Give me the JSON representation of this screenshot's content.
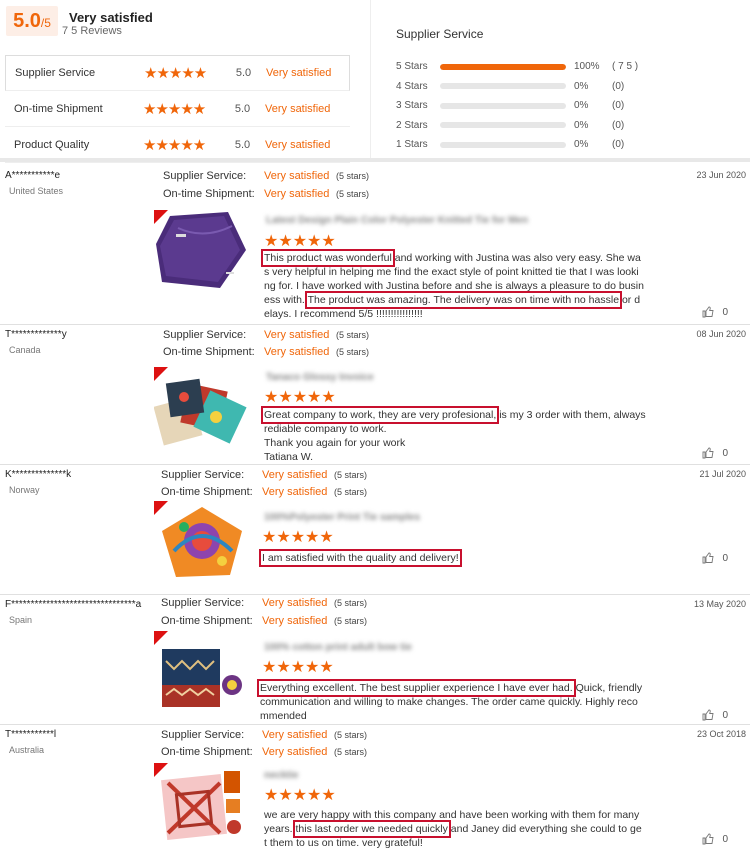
{
  "summary": {
    "score": "5.0",
    "score_suffix": "/5",
    "label": "Very satisfied",
    "review_count": "7 5 Reviews",
    "rows": [
      {
        "label": "Supplier Service",
        "score": "5.0",
        "word": "Very satisfied",
        "stars": 5
      },
      {
        "label": "On-time Shipment",
        "score": "5.0",
        "word": "Very satisfied",
        "stars": 5
      },
      {
        "label": "Product Quality",
        "score": "5.0",
        "word": "Very satisfied",
        "stars": 5
      }
    ],
    "breakdown_title": "Supplier Service",
    "breakdown": [
      {
        "label": "5 Stars",
        "fraction": 1.0,
        "pct": "100%",
        "count": "( 7 5 )"
      },
      {
        "label": "4 Stars",
        "fraction": 0,
        "pct": "0%",
        "count": "(0)"
      },
      {
        "label": "3 Stars",
        "fraction": 0,
        "pct": "0%",
        "count": "(0)"
      },
      {
        "label": "2 Stars",
        "fraction": 0,
        "pct": "0%",
        "count": "(0)"
      },
      {
        "label": "1 Stars",
        "fraction": 0,
        "pct": "0%",
        "count": "(0)"
      }
    ]
  },
  "labels": {
    "supplier_service": "Supplier Service:",
    "on_time_shipment": "On-time Shipment:",
    "very_satisfied": "Very satisfied",
    "five_stars": "(5 stars)",
    "star_glyphs": "★★★★★",
    "likes": "0"
  },
  "reviews": [
    {
      "name": "A***********e",
      "country": "United States",
      "date": "23 Jun 2020",
      "product_title": "Latest Design Plain Color Polyester Knitted Tie for Men",
      "lines": [
        "This product was wonderful and working with Justina was also very easy. She wa",
        "s very helpful in helping me find the exact style of point knitted tie that I was looki",
        "ng for. I have worked with Justina before and she is always a pleasure to do busin",
        "ess with. The product was amazing. The delivery was on time with no hassle or d",
        "elays. I recommend 5/5 !!!!!!!!!!!!!!!!"
      ],
      "highlights": [
        "This product was wonderful",
        "The product was amazing. The delivery was on time with no hassle"
      ]
    },
    {
      "name": "T*************y",
      "country": "Canada",
      "date": "08 Jun 2020",
      "product_title": "Tanaco Glossy Invoice",
      "lines": [
        "Great company to work, they are very profesional, is my 3 order with them, always",
        "rediable company to work.",
        "Thank you again for your work",
        "Tatiana W."
      ],
      "highlights": [
        "Great company to work, they are very profesional,"
      ]
    },
    {
      "name": "K**************k",
      "country": "Norway",
      "date": "21 Jul 2020",
      "product_title": "100%Polyester Print Tie samples",
      "lines": [
        "I am satisfied with the quality and delivery!"
      ],
      "highlights": [
        "I am satisfied with the quality and delivery!"
      ]
    },
    {
      "name": "F********************************a",
      "country": "Spain",
      "date": "13 May 2020",
      "product_title": "100% cotton print adult bow tie",
      "lines": [
        "Everything excellent. The best supplier experience I have ever had. Quick, friendly",
        "communication and willing to make changes. The order came quickly. Highly reco",
        "mmended"
      ],
      "highlights": [
        "Everything excellent. The best supplier experience I have ever had."
      ]
    },
    {
      "name": "T***********l",
      "country": "Australia",
      "date": "23 Oct 2018",
      "product_title": "necktie",
      "lines": [
        "we are very happy with this company and have been working with them for many",
        "years. this last order we needed quickly and Janey did everything she could to ge",
        "t them to us on time.  very grateful!"
      ],
      "highlights": [
        "this last order we needed quickly"
      ]
    }
  ]
}
